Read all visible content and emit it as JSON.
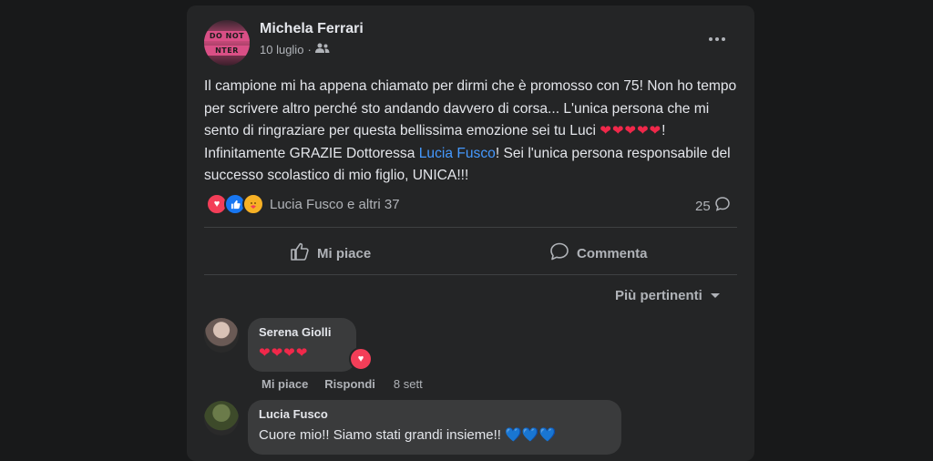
{
  "post": {
    "author": "Michela Ferrari",
    "date": "10 luglio",
    "date_sep": "·",
    "avatar_text_top": "DO NOT",
    "avatar_text_bottom": "NTER",
    "text_part1": "Il campione mi ha appena chiamato per dirmi che è promosso con 75! Non ho tempo per scrivere altro perché sto andando davvero di corsa... L'unica persona che mi sento di ringraziare per questa bellissima emozione sei tu Luci ",
    "hearts": "❤❤❤❤❤",
    "text_part2": "! Infinitamente GRAZIE Dottoressa ",
    "mention": "Lucia Fusco",
    "text_part3": "! Sei l'unica persona responsabile del successo scolastico di mio figlio, UNICA!!!",
    "reactors": "Lucia Fusco e altri 37",
    "comment_count": "25",
    "reaction_icons": [
      "love-icon",
      "like-icon",
      "care-icon"
    ]
  },
  "actions": {
    "like": "Mi piace",
    "comment": "Commenta"
  },
  "sort_label": "Più pertinenti",
  "comments": [
    {
      "name": "Serena Giolli",
      "text": "❤❤❤❤",
      "like": "Mi piace",
      "reply": "Rispondi",
      "time": "8 sett"
    },
    {
      "name": "Lucia Fusco",
      "text": "Cuore mio!! Siamo stati grandi insieme!! ",
      "hearts": "💙💙💙"
    }
  ],
  "colors": {
    "background": "#18191a",
    "card": "#242526",
    "bubble": "#3a3b3c",
    "link": "#4599ff",
    "heart": "#f0284a"
  }
}
